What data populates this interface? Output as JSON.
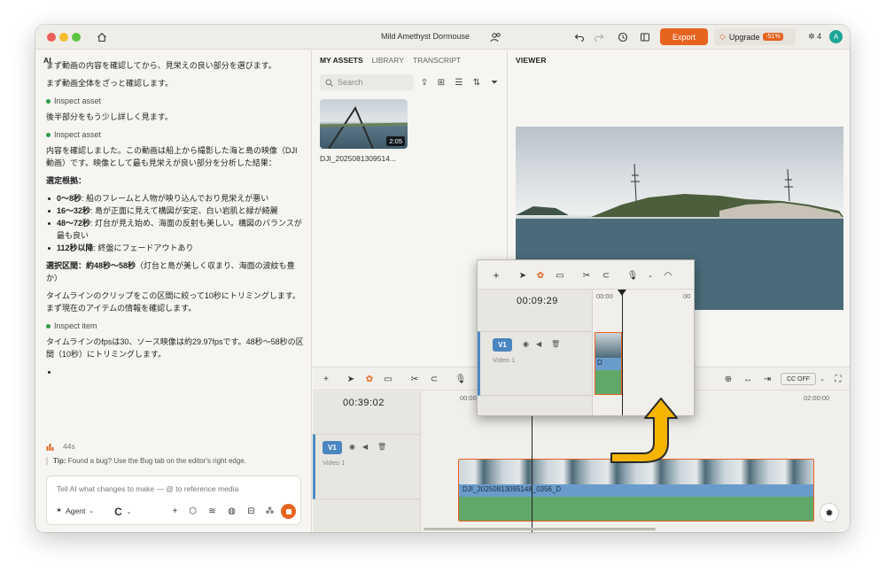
{
  "titlebar": {
    "title": "Mild Amethyst Dormouse",
    "export_label": "Export",
    "upgrade_label": "Upgrade",
    "upgrade_badge": "-51%",
    "credits": "4",
    "avatar_letter": "A"
  },
  "ai": {
    "panel_title": "AI",
    "messages": {
      "m0": "まず動画の内容を確認してから、見栄えの良い部分を選びます。",
      "m1": "まず動画全体をざっと確認します。",
      "inspect1": "Inspect asset",
      "m2": "後半部分をもう少し詳しく見ます。",
      "inspect2": "Inspect asset",
      "m3": "内容を確認しました。この動画は船上から撮影した海と島の映像（DJI動画）です。映像として最も見栄えが良い部分を分析した結果：",
      "heading": "選定根拠：",
      "b1_bold": "0〜8秒",
      "b1_text": ": 船のフレームと人物が映り込んでおり見栄えが悪い",
      "b2_bold": "16〜32秒",
      "b2_text": ": 島が正面に見えて構図が安定、白い岩肌と緑が綺麗",
      "b3_bold": "48〜72秒",
      "b3_text": ": 灯台が見え始め、海面の反射も美しい。構図のバランスが最も良い",
      "b4_bold": "112秒以降",
      "b4_text": ": 終盤にフェードアウトあり",
      "sel_bold": "選択区間：約48秒〜58秒",
      "sel_text": "（灯台と島が美しく収まり、海面の波紋も豊か）",
      "m4": "タイムラインのクリップをこの区間に絞って10秒にトリミングします。まず現在のアイテムの情報を確認します。",
      "inspect3": "Inspect item",
      "m5": "タイムラインのfpsは30、ソース映像は約29.97fpsです。48秒〜58秒の区間（10秒）にトリミングします。"
    },
    "elapsed": "44s",
    "tip_bold": "Tip:",
    "tip_text": " Found a bug? Use the Bug tab on the editor's right edge.",
    "prompt_placeholder": "Tell AI what changes to make — @ to reference media",
    "agent_label": "Agent"
  },
  "assets": {
    "tabs": [
      "MY ASSETS",
      "LIBRARY",
      "TRANSCRIPT"
    ],
    "search_placeholder": "Search",
    "item_name": "DJI_2025081309514...",
    "item_duration": "2:05"
  },
  "viewer": {
    "title": "VIEWER"
  },
  "timeline": {
    "timecode": "00:39:02",
    "track_label": "V1",
    "track_name": "Video 1",
    "ruler": [
      "00:00",
      "02:00:00"
    ],
    "clip_name": "DJI_20250813095148_0356_D",
    "cc_label": "CC OFF"
  },
  "inset": {
    "timecode": "00:09:29",
    "ruler": [
      "00:00",
      "00"
    ],
    "track_label": "V1",
    "track_name": "Video 1",
    "clip_label": "D"
  },
  "colors": {
    "accent": "#e7641f",
    "track_blue": "#4a86c0",
    "audio_green": "#5fa86a",
    "callout_arrow": "#f5b400"
  }
}
